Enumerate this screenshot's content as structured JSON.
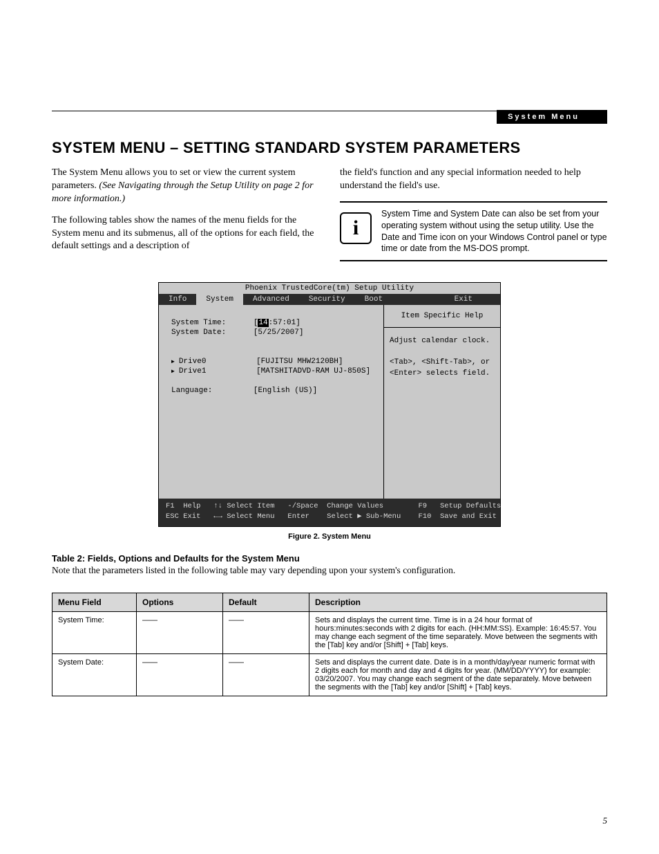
{
  "header": {
    "section_label": "System Menu"
  },
  "title": "SYSTEM MENU – SETTING STANDARD SYSTEM PARAMETERS",
  "intro": {
    "p1a": "The System Menu allows you to set or view the current system parameters. ",
    "p1b": "(See Navigating through the Setup Utility on page 2 for more information.)",
    "p2": "The following tables show the names of the menu fields for the System menu and its submenus, all of the options for each field, the default settings and a description of",
    "p3": "the field's function and any special information needed to help understand the field's use.",
    "note": "System Time and System Date can also be set from your operating system without using the setup utility. Use the Date and Time icon on your Windows Control panel or type time or date from the MS-DOS prompt."
  },
  "bios": {
    "app_title": "Phoenix TrustedCore(tm) Setup Utility",
    "tabs": [
      "Info",
      "System",
      "Advanced",
      "Security",
      "Boot",
      "Exit"
    ],
    "active_tab": "System",
    "rows": {
      "time_label": "System Time:",
      "time_value_sel": "14",
      "time_value_rest": ":57:01]",
      "date_label": "System Date:",
      "date_value": "[5/25/2007]",
      "drive0": "Drive0",
      "drive0_val": "[FUJITSU MHW2120BH]",
      "drive1": "Drive1",
      "drive1_val": "[MATSHITADVD-RAM UJ-850S]",
      "lang_label": "Language:",
      "lang_val": "[English (US)]"
    },
    "help": {
      "title": "Item Specific Help",
      "body1": "Adjust calendar clock.",
      "body2": "<Tab>, <Shift-Tab>, or",
      "body3": "<Enter> selects field."
    },
    "footer": {
      "line1": "F1  Help   ↑↓ Select Item   -/Space  Change Values        F9   Setup Defaults",
      "line2": "ESC Exit   ←→ Select Menu   Enter    Select ▶ Sub-Menu    F10  Save and Exit"
    }
  },
  "figure_caption": "Figure 2.   System Menu",
  "table_section": {
    "title": "Table 2: Fields, Options and Defaults for the System Menu",
    "note": "Note that the parameters listed in the following table may vary depending upon your system's configuration.",
    "headers": [
      "Menu Field",
      "Options",
      "Default",
      "Description"
    ],
    "rows": [
      {
        "field": "System Time:",
        "options": "——",
        "default": "——",
        "desc": "Sets and displays the current time. Time is in a 24 hour format of hours:minutes:seconds with 2 digits for each. (HH:MM:SS). Example: 16:45:57. You may change each segment of the time separately. Move between the segments with the [Tab] key and/or [Shift] + [Tab] keys."
      },
      {
        "field": "System Date:",
        "options": "——",
        "default": "——",
        "desc": "Sets and displays the current date. Date is in a month/day/year numeric format with 2 digits each for month and day and 4 digits for year. (MM/DD/YYYY) for example: 03/20/2007. You may change each segment of the date separately. Move between the segments with the [Tab] key and/or [Shift] + [Tab] keys."
      }
    ]
  },
  "page_number": "5"
}
